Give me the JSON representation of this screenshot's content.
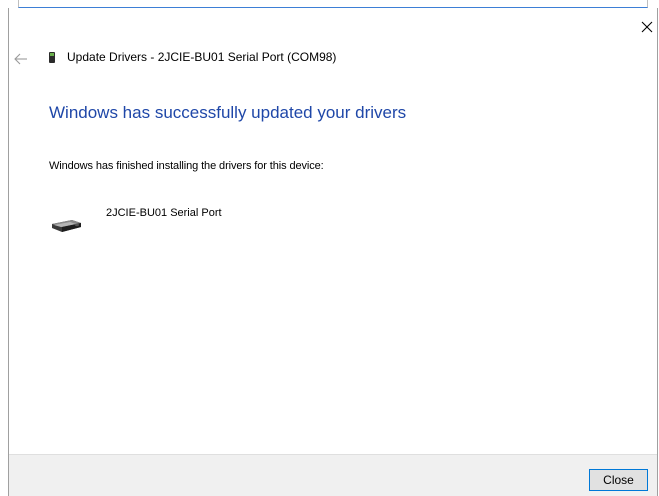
{
  "window": {
    "title": "Update Drivers - 2JCIE-BU01 Serial Port (COM98)"
  },
  "main": {
    "heading": "Windows has successfully updated your drivers",
    "description": "Windows has finished installing the drivers for this device:",
    "device_name": "2JCIE-BU01 Serial Port"
  },
  "footer": {
    "close_label": "Close"
  },
  "icons": {
    "close": "close-icon",
    "back": "back-arrow-icon",
    "title_device": "usb-device-icon",
    "device": "serial-port-device-icon"
  },
  "colors": {
    "heading": "#1f47a8",
    "button_border": "#0078d7",
    "footer_bg": "#f0f0f0"
  }
}
